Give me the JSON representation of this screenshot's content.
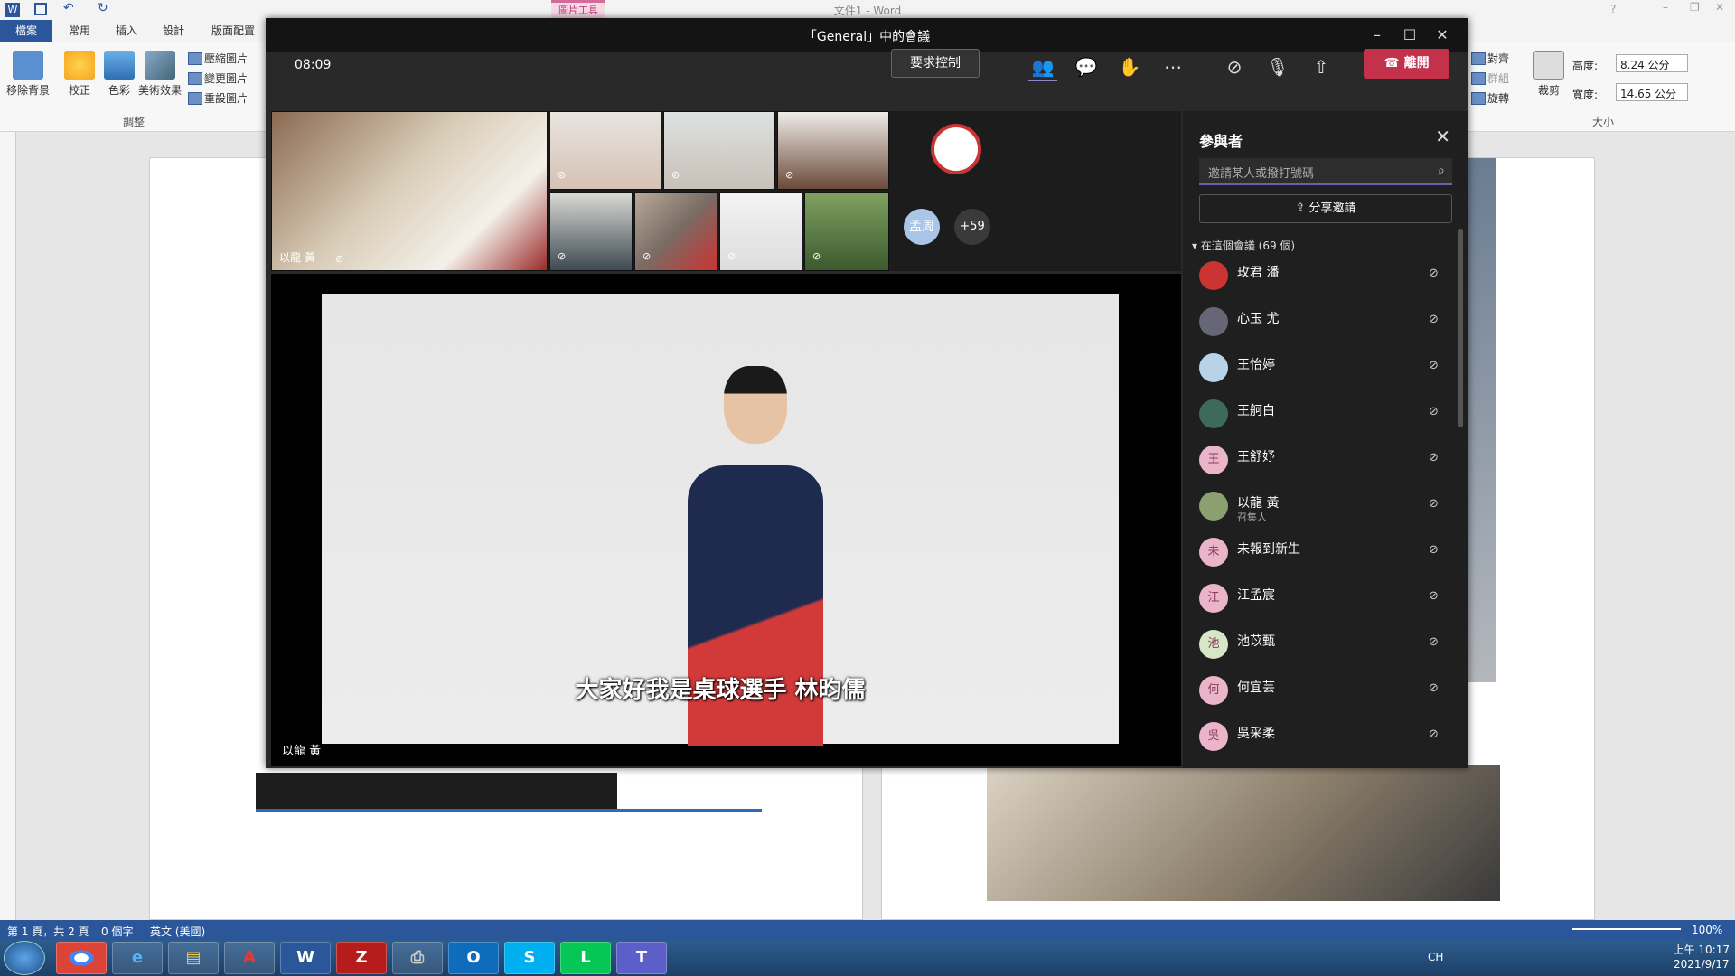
{
  "word": {
    "doc_title": "文件1 - Word",
    "pic_tools": "圖片工具",
    "tabs": [
      "檔案",
      "常用",
      "插入",
      "設計",
      "版面配置"
    ],
    "ribbon": {
      "remove_bg": "移除背景",
      "correct": "校正",
      "color": "色彩",
      "art_effects": "美術效果",
      "compress": "壓縮圖片",
      "change": "變更圖片",
      "reset": "重設圖片",
      "adjust_group": "調整",
      "align": "對齊",
      "group": "群組",
      "rotate": "旋轉",
      "crop": "裁剪",
      "height_label": "高度:",
      "height_value": "8.24 公分",
      "width_label": "寬度:",
      "width_value": "14.65 公分",
      "size_group": "大小"
    },
    "status": {
      "page": "第 1 頁，共 2 頁",
      "words": "0 個字",
      "lang": "英文 (美國)",
      "zoom": "100%"
    }
  },
  "taskbar": {
    "apps": [
      "chrome",
      "ie",
      "explorer",
      "pdf",
      "word",
      "filezilla",
      "printer",
      "outlook",
      "skype",
      "line",
      "teams"
    ],
    "time": "上午 10:17",
    "date": "2021/9/17",
    "lang": "CH"
  },
  "teams": {
    "title": "「General」中的會議",
    "timer": "08:09",
    "request_control": "要求控制",
    "leave": "離開",
    "gallery": {
      "main_tile_name": "以龍 黃",
      "avatar_initials": "孟周",
      "overflow_count": "+59"
    },
    "stage": {
      "caption": "大家好我是桌球選手 林昀儒",
      "name": "以龍 黃"
    },
    "panel": {
      "title": "參與者",
      "invite_placeholder": "邀請某人或撥打號碼",
      "share_invite": "分享邀請",
      "in_meeting": "在這個會議 (69 個)",
      "participants": [
        {
          "name": "玫君 潘",
          "role": "",
          "avatar": ""
        },
        {
          "name": "心玉 尤",
          "role": "",
          "avatar": ""
        },
        {
          "name": "王怡婷",
          "role": "",
          "avatar": ""
        },
        {
          "name": "王舸白",
          "role": "",
          "avatar": ""
        },
        {
          "name": "王舒妤",
          "role": "",
          "avatar": "王"
        },
        {
          "name": "以龍 黃",
          "role": "召集人",
          "avatar": ""
        },
        {
          "name": "未報到新生",
          "role": "",
          "avatar": "未"
        },
        {
          "name": "江孟宸",
          "role": "",
          "avatar": "江"
        },
        {
          "name": "池苡甄",
          "role": "",
          "avatar": "池"
        },
        {
          "name": "何宜芸",
          "role": "",
          "avatar": "何"
        },
        {
          "name": "吳采柔",
          "role": "",
          "avatar": "吳"
        }
      ]
    }
  }
}
